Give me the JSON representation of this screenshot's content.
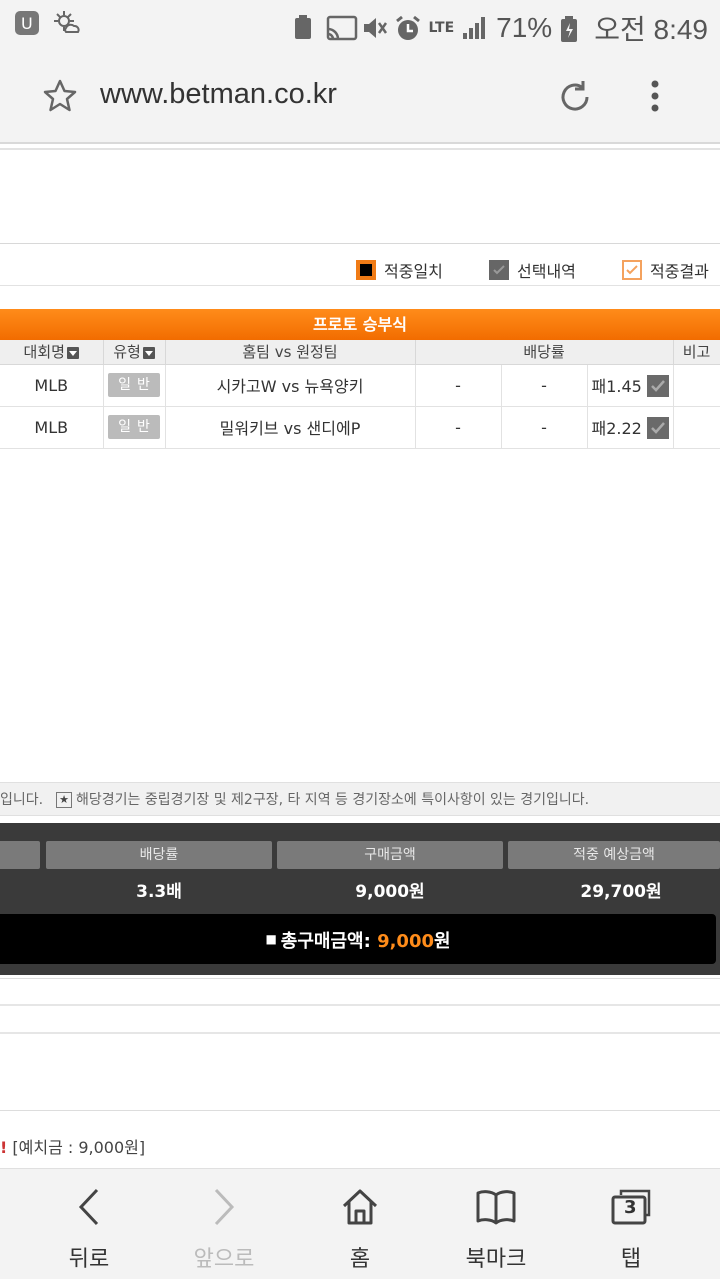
{
  "status_bar": {
    "battery": "71%",
    "time": "오전 8:49",
    "network": "LTE"
  },
  "browser": {
    "url": "www.betman.co.kr"
  },
  "legend": {
    "items": [
      {
        "label": "적중일치"
      },
      {
        "label": "선택내역"
      },
      {
        "label": "적중결과"
      }
    ]
  },
  "banner": {
    "title": "프로토 승부식"
  },
  "table": {
    "headers": {
      "league": "대회명",
      "type": "유형",
      "match": "홈팀 vs 원정팀",
      "odds": "배당률",
      "note": "비고"
    },
    "rows": [
      {
        "league": "MLB",
        "type": "일반",
        "home": "시카고W",
        "vs": "vs",
        "away": "뉴욕양키",
        "win": "-",
        "draw": "-",
        "pick": "패1.45"
      },
      {
        "league": "MLB",
        "type": "일반",
        "home": "밀워키브",
        "vs": "vs",
        "away": "샌디에P",
        "win": "-",
        "draw": "-",
        "pick": "패2.22"
      }
    ]
  },
  "notice": {
    "left": "입니다.",
    "star": "★",
    "right": "해당경기는 중립경기장 및 제2구장, 타 지역 등 경기장소에 특이사항이 있는 경기입니다."
  },
  "summary": {
    "headers": [
      "배당률",
      "구매금액",
      "적중 예상금액"
    ],
    "values": [
      "3.3배",
      "9,000원",
      "29,700원"
    ],
    "total_label": "총구매금액:",
    "total_amount": "9,000",
    "total_unit": "원"
  },
  "deposit": {
    "mark": "!",
    "text": "[예치금 : 9,000원]"
  },
  "bottom_nav": {
    "back": "뒤로",
    "forward": "앞으로",
    "home": "홈",
    "bookmarks": "북마크",
    "tabs": "탭",
    "tab_count": "3"
  },
  "colors": {
    "accent": "#f26c00",
    "summary_bg": "#3a3a3a"
  }
}
